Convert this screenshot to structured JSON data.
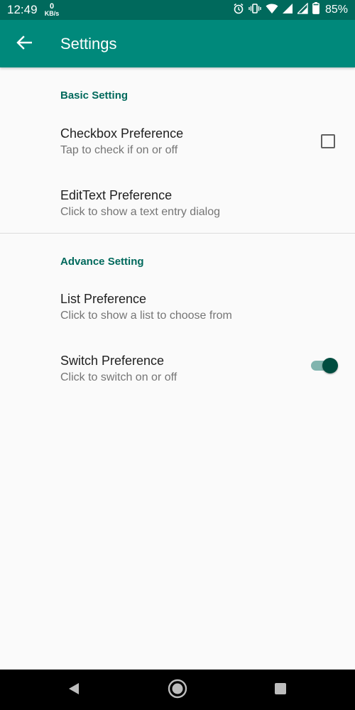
{
  "status_bar": {
    "time": "12:49",
    "net_speed_value": "0",
    "net_speed_unit": "KB/s",
    "icons": [
      "alarm-icon",
      "vibrate-icon",
      "wifi-icon",
      "signal-icon",
      "signal-icon",
      "battery-icon"
    ],
    "battery": "85%"
  },
  "app_bar": {
    "title": "Settings",
    "back_icon": "arrow-back-icon",
    "color": "#00897b"
  },
  "sections": [
    {
      "header": "Basic Setting",
      "items": [
        {
          "title": "Checkbox Preference",
          "summary": "Tap to check if on or off",
          "widget": "checkbox",
          "checked": false
        },
        {
          "title": "EditText Preference",
          "summary": "Click to show a text entry dialog"
        }
      ]
    },
    {
      "header": "Advance Setting",
      "items": [
        {
          "title": "List Preference",
          "summary": "Click to show a list to choose from"
        },
        {
          "title": "Switch Preference",
          "summary": "Click to switch on or off",
          "widget": "switch",
          "on": true
        }
      ]
    }
  ],
  "colors": {
    "accent": "#00695c",
    "status_bar": "#00695c",
    "switch_thumb": "#004d40",
    "switch_track": "#80b4ae"
  },
  "nav_bar": {
    "icons": [
      "back-triangle-icon",
      "home-circle-icon",
      "recents-square-icon"
    ]
  }
}
